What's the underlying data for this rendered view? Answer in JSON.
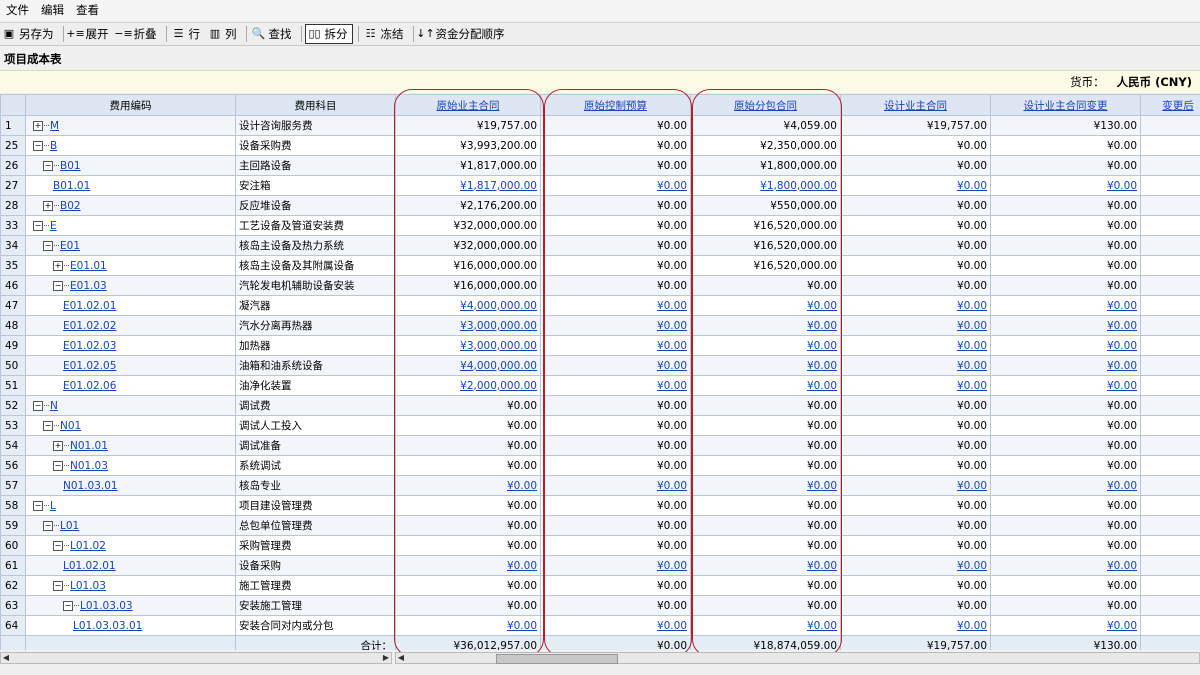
{
  "menu": [
    "文件",
    "编辑",
    "查看"
  ],
  "toolbar": [
    {
      "icon": "save-icon",
      "glyph": "▣",
      "label": "另存为",
      "active": false,
      "name": "save-as-button"
    },
    {
      "icon": "expand-icon",
      "glyph": "+≡",
      "label": "展开",
      "active": false,
      "name": "expand-button"
    },
    {
      "icon": "collapse-icon",
      "glyph": "−≡",
      "label": "折叠",
      "active": false,
      "name": "collapse-button"
    },
    {
      "icon": "rows-icon",
      "glyph": "☰",
      "label": "行",
      "active": false,
      "name": "rows-button"
    },
    {
      "icon": "columns-icon",
      "glyph": "▥",
      "label": "列",
      "active": false,
      "name": "columns-button"
    },
    {
      "icon": "search-icon",
      "glyph": "🔍",
      "label": "查找",
      "active": false,
      "name": "find-button"
    },
    {
      "icon": "split-icon",
      "glyph": "▯▯",
      "label": "拆分",
      "active": true,
      "name": "split-button"
    },
    {
      "icon": "freeze-icon",
      "glyph": "☷",
      "label": "冻结",
      "active": false,
      "name": "freeze-button"
    },
    {
      "icon": "sort-icon",
      "glyph": "↓↑",
      "label": "资金分配顺序",
      "active": false,
      "name": "fund-order-button"
    }
  ],
  "page_title": "项目成本表",
  "currency": {
    "label": "货币：",
    "value": "人民币 (CNY)"
  },
  "columns": [
    "",
    "费用编码",
    "费用科目",
    "原始业主合同",
    "原始控制预算",
    "原始分包合同",
    "设计业主合同",
    "设计业主合同变更",
    "变更后"
  ],
  "rows": [
    {
      "n": "1",
      "lvl": 0,
      "tg": "+",
      "code": "M",
      "name": "设计咨询服务费",
      "v": [
        "¥19,757.00",
        "¥0.00",
        "¥4,059.00",
        "¥19,757.00",
        "¥130.00"
      ],
      "lnk": false
    },
    {
      "n": "25",
      "lvl": 0,
      "tg": "−",
      "code": "B",
      "name": "设备采购费",
      "v": [
        "¥3,993,200.00",
        "¥0.00",
        "¥2,350,000.00",
        "¥0.00",
        "¥0.00"
      ],
      "lnk": false
    },
    {
      "n": "26",
      "lvl": 1,
      "tg": "−",
      "code": "B01",
      "name": "主回路设备",
      "v": [
        "¥1,817,000.00",
        "¥0.00",
        "¥1,800,000.00",
        "¥0.00",
        "¥0.00"
      ],
      "lnk": false
    },
    {
      "n": "27",
      "lvl": 2,
      "tg": "",
      "code": "B01.01",
      "name": "安注箱",
      "v": [
        "¥1,817,000.00",
        "¥0.00",
        "¥1,800,000.00",
        "¥0.00",
        "¥0.00"
      ],
      "lnk": true
    },
    {
      "n": "28",
      "lvl": 1,
      "tg": "+",
      "code": "B02",
      "name": "反应堆设备",
      "v": [
        "¥2,176,200.00",
        "¥0.00",
        "¥550,000.00",
        "¥0.00",
        "¥0.00"
      ],
      "lnk": false
    },
    {
      "n": "33",
      "lvl": 0,
      "tg": "−",
      "code": "E",
      "name": "工艺设备及管道安装费",
      "v": [
        "¥32,000,000.00",
        "¥0.00",
        "¥16,520,000.00",
        "¥0.00",
        "¥0.00"
      ],
      "lnk": false
    },
    {
      "n": "34",
      "lvl": 1,
      "tg": "−",
      "code": "E01",
      "name": "核岛主设备及热力系统",
      "v": [
        "¥32,000,000.00",
        "¥0.00",
        "¥16,520,000.00",
        "¥0.00",
        "¥0.00"
      ],
      "lnk": false
    },
    {
      "n": "35",
      "lvl": 2,
      "tg": "+",
      "code": "E01.01",
      "name": "核岛主设备及其附属设备",
      "v": [
        "¥16,000,000.00",
        "¥0.00",
        "¥16,520,000.00",
        "¥0.00",
        "¥0.00"
      ],
      "lnk": false
    },
    {
      "n": "46",
      "lvl": 2,
      "tg": "−",
      "code": "E01.03",
      "name": "汽轮发电机辅助设备安装",
      "v": [
        "¥16,000,000.00",
        "¥0.00",
        "¥0.00",
        "¥0.00",
        "¥0.00"
      ],
      "lnk": false
    },
    {
      "n": "47",
      "lvl": 3,
      "tg": "",
      "code": "E01.02.01",
      "name": "凝汽器",
      "v": [
        "¥4,000,000.00",
        "¥0.00",
        "¥0.00",
        "¥0.00",
        "¥0.00"
      ],
      "lnk": true
    },
    {
      "n": "48",
      "lvl": 3,
      "tg": "",
      "code": "E01.02.02",
      "name": "汽水分离再热器",
      "v": [
        "¥3,000,000.00",
        "¥0.00",
        "¥0.00",
        "¥0.00",
        "¥0.00"
      ],
      "lnk": true
    },
    {
      "n": "49",
      "lvl": 3,
      "tg": "",
      "code": "E01.02.03",
      "name": "加热器",
      "v": [
        "¥3,000,000.00",
        "¥0.00",
        "¥0.00",
        "¥0.00",
        "¥0.00"
      ],
      "lnk": true
    },
    {
      "n": "50",
      "lvl": 3,
      "tg": "",
      "code": "E01.02.05",
      "name": "油箱和油系统设备",
      "v": [
        "¥4,000,000.00",
        "¥0.00",
        "¥0.00",
        "¥0.00",
        "¥0.00"
      ],
      "lnk": true
    },
    {
      "n": "51",
      "lvl": 3,
      "tg": "",
      "code": "E01.02.06",
      "name": "油净化装置",
      "v": [
        "¥2,000,000.00",
        "¥0.00",
        "¥0.00",
        "¥0.00",
        "¥0.00"
      ],
      "lnk": true
    },
    {
      "n": "52",
      "lvl": 0,
      "tg": "−",
      "code": "N",
      "name": "调试费",
      "v": [
        "¥0.00",
        "¥0.00",
        "¥0.00",
        "¥0.00",
        "¥0.00"
      ],
      "lnk": false
    },
    {
      "n": "53",
      "lvl": 1,
      "tg": "−",
      "code": "N01",
      "name": "调试人工投入",
      "v": [
        "¥0.00",
        "¥0.00",
        "¥0.00",
        "¥0.00",
        "¥0.00"
      ],
      "lnk": false
    },
    {
      "n": "54",
      "lvl": 2,
      "tg": "+",
      "code": "N01.01",
      "name": "调试准备",
      "v": [
        "¥0.00",
        "¥0.00",
        "¥0.00",
        "¥0.00",
        "¥0.00"
      ],
      "lnk": false
    },
    {
      "n": "56",
      "lvl": 2,
      "tg": "−",
      "code": "N01.03",
      "name": "系统调试",
      "v": [
        "¥0.00",
        "¥0.00",
        "¥0.00",
        "¥0.00",
        "¥0.00"
      ],
      "lnk": false
    },
    {
      "n": "57",
      "lvl": 3,
      "tg": "",
      "code": "N01.03.01",
      "name": "核岛专业",
      "v": [
        "¥0.00",
        "¥0.00",
        "¥0.00",
        "¥0.00",
        "¥0.00"
      ],
      "lnk": true
    },
    {
      "n": "58",
      "lvl": 0,
      "tg": "−",
      "code": "L",
      "name": "项目建设管理费",
      "v": [
        "¥0.00",
        "¥0.00",
        "¥0.00",
        "¥0.00",
        "¥0.00"
      ],
      "lnk": false
    },
    {
      "n": "59",
      "lvl": 1,
      "tg": "−",
      "code": "L01",
      "name": "总包单位管理费",
      "v": [
        "¥0.00",
        "¥0.00",
        "¥0.00",
        "¥0.00",
        "¥0.00"
      ],
      "lnk": false
    },
    {
      "n": "60",
      "lvl": 2,
      "tg": "−",
      "code": "L01.02",
      "name": "采购管理费",
      "v": [
        "¥0.00",
        "¥0.00",
        "¥0.00",
        "¥0.00",
        "¥0.00"
      ],
      "lnk": false
    },
    {
      "n": "61",
      "lvl": 3,
      "tg": "",
      "code": "L01.02.01",
      "name": "设备采购",
      "v": [
        "¥0.00",
        "¥0.00",
        "¥0.00",
        "¥0.00",
        "¥0.00"
      ],
      "lnk": true
    },
    {
      "n": "62",
      "lvl": 2,
      "tg": "−",
      "code": "L01.03",
      "name": "施工管理费",
      "v": [
        "¥0.00",
        "¥0.00",
        "¥0.00",
        "¥0.00",
        "¥0.00"
      ],
      "lnk": false
    },
    {
      "n": "63",
      "lvl": 3,
      "tg": "−",
      "code": "L01.03.03",
      "name": "安装施工管理",
      "v": [
        "¥0.00",
        "¥0.00",
        "¥0.00",
        "¥0.00",
        "¥0.00"
      ],
      "lnk": false
    },
    {
      "n": "64",
      "lvl": 4,
      "tg": "",
      "code": "L01.03.03.01",
      "name": "安装合同对内或分包",
      "v": [
        "¥0.00",
        "¥0.00",
        "¥0.00",
        "¥0.00",
        "¥0.00"
      ],
      "lnk": true
    }
  ],
  "totals": {
    "label": "合计：",
    "v": [
      "¥36,012,957.00",
      "¥0.00",
      "¥18,874,059.00",
      "¥19,757.00",
      "¥130.00"
    ]
  },
  "highlight_color": "#b0202a",
  "link_color": "#1a44b8"
}
